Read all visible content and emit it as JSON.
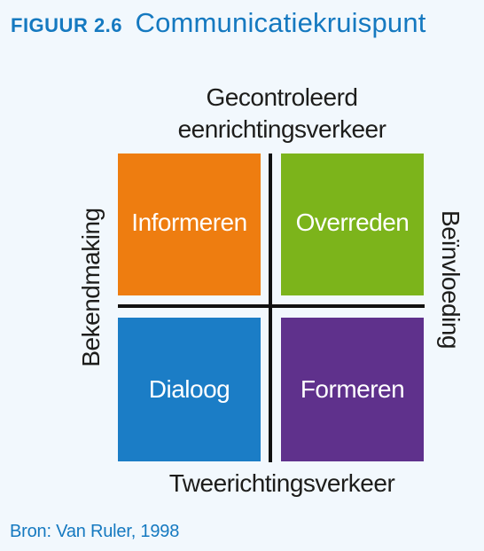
{
  "header": {
    "label": "FIGUUR 2.6",
    "title": "Communicatiekruispunt"
  },
  "axes": {
    "top_line1": "Gecontroleerd",
    "top_line2": "eenrichtingsverkeer",
    "bottom": "Tweerichtingsverkeer",
    "left": "Bekendmaking",
    "right": "Beïnvloeding"
  },
  "quadrants": [
    {
      "label": "Informeren",
      "color": "#ee7d10"
    },
    {
      "label": "Overreden",
      "color": "#7cb41b"
    },
    {
      "label": "Dialoog",
      "color": "#1b7dc6"
    },
    {
      "label": "Formeren",
      "color": "#5f318c"
    }
  ],
  "source": "Bron: Van Ruler, 1998",
  "colors": {
    "accent": "#1579c0",
    "background": "#f2f8fd",
    "text": "#1d1d1b",
    "divider": "#111111"
  }
}
